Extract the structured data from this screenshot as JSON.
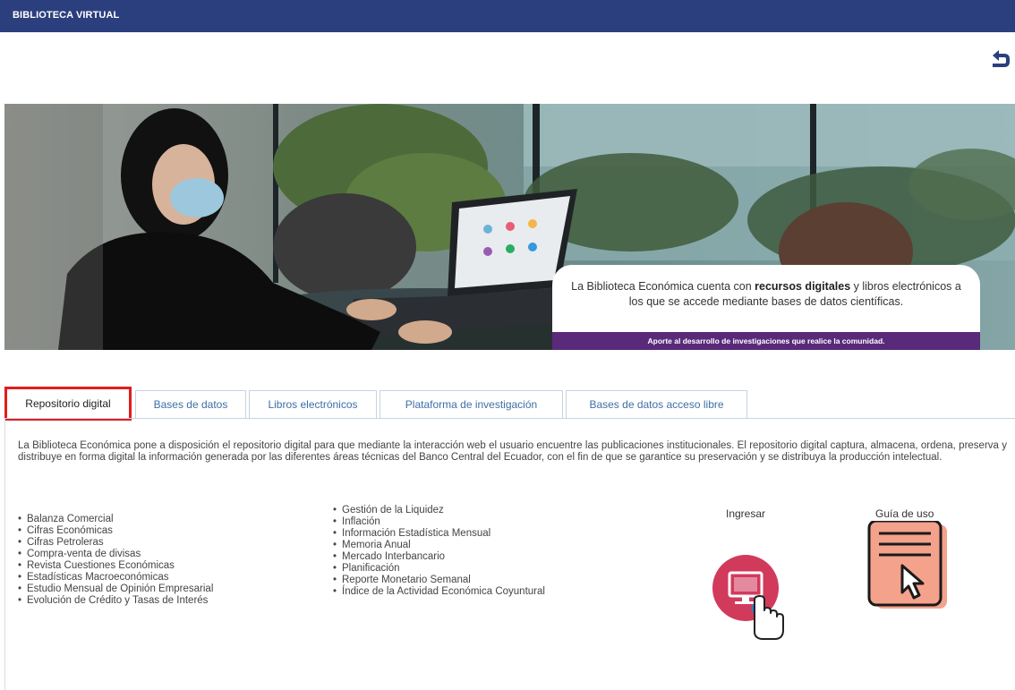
{
  "header": {
    "title": "BIBLIOTECA VIRTUAL"
  },
  "back_button": {
    "icon": "undo-arrow-icon",
    "color": "#2b3f7e"
  },
  "banner": {
    "message_pre": "La Biblioteca Económica cuenta con ",
    "message_bold": "recursos digitales",
    "message_post": " y libros electrónicos a los que se accede mediante bases de datos científicas.",
    "strip": "Aporte al desarrollo de investigaciones que realice la comunidad.",
    "strip_color": "#5a2a7a"
  },
  "tabs": [
    {
      "label": "Repositorio digital",
      "active": true
    },
    {
      "label": "Bases de datos",
      "active": false
    },
    {
      "label": "Libros electrónicos",
      "active": false
    },
    {
      "label": "Plataforma de investigación",
      "active": false
    },
    {
      "label": "Bases de datos acceso libre",
      "active": false
    }
  ],
  "content": {
    "intro": "La Biblioteca Económica pone a disposición el repositorio digital para que mediante la interacción web el usuario encuentre las publicaciones institucionales. El repositorio digital captura, almacena, ordena, preserva y distribuye en forma digital la información generada por las diferentes áreas técnicas del Banco Central del Ecuador, con el fin de que se garantice su preservación y se distribuya la producción intelectual.",
    "list_left": [
      "Balanza Comercial",
      "Cifras Económicas",
      "Cifras Petroleras",
      "Compra-venta de divisas",
      "Revista Cuestiones Económicas",
      "Estadísticas Macroeconómicas",
      "Estudio Mensual de Opinión Empresarial",
      "Evolución de Crédito y Tasas de Interés"
    ],
    "list_right": [
      "Gestión de la Liquidez",
      "Inflación",
      "Información Estadística Mensual",
      "Memoria Anual",
      "Mercado Interbancario",
      "Planificación",
      "Reporte Monetario Semanal",
      "Índice de la Actividad Económica Coyuntural"
    ]
  },
  "actions": {
    "ingresar": {
      "label": "Ingresar",
      "icon": "computer-click-icon",
      "color": "#d23a5c"
    },
    "guia": {
      "label": "Guía de uso",
      "icon": "document-cursor-icon",
      "color": "#f4a28c"
    }
  },
  "colors": {
    "header": "#2b3f7e",
    "tab_text": "#3e6fa6",
    "active_tab_border": "#e01d1d"
  }
}
